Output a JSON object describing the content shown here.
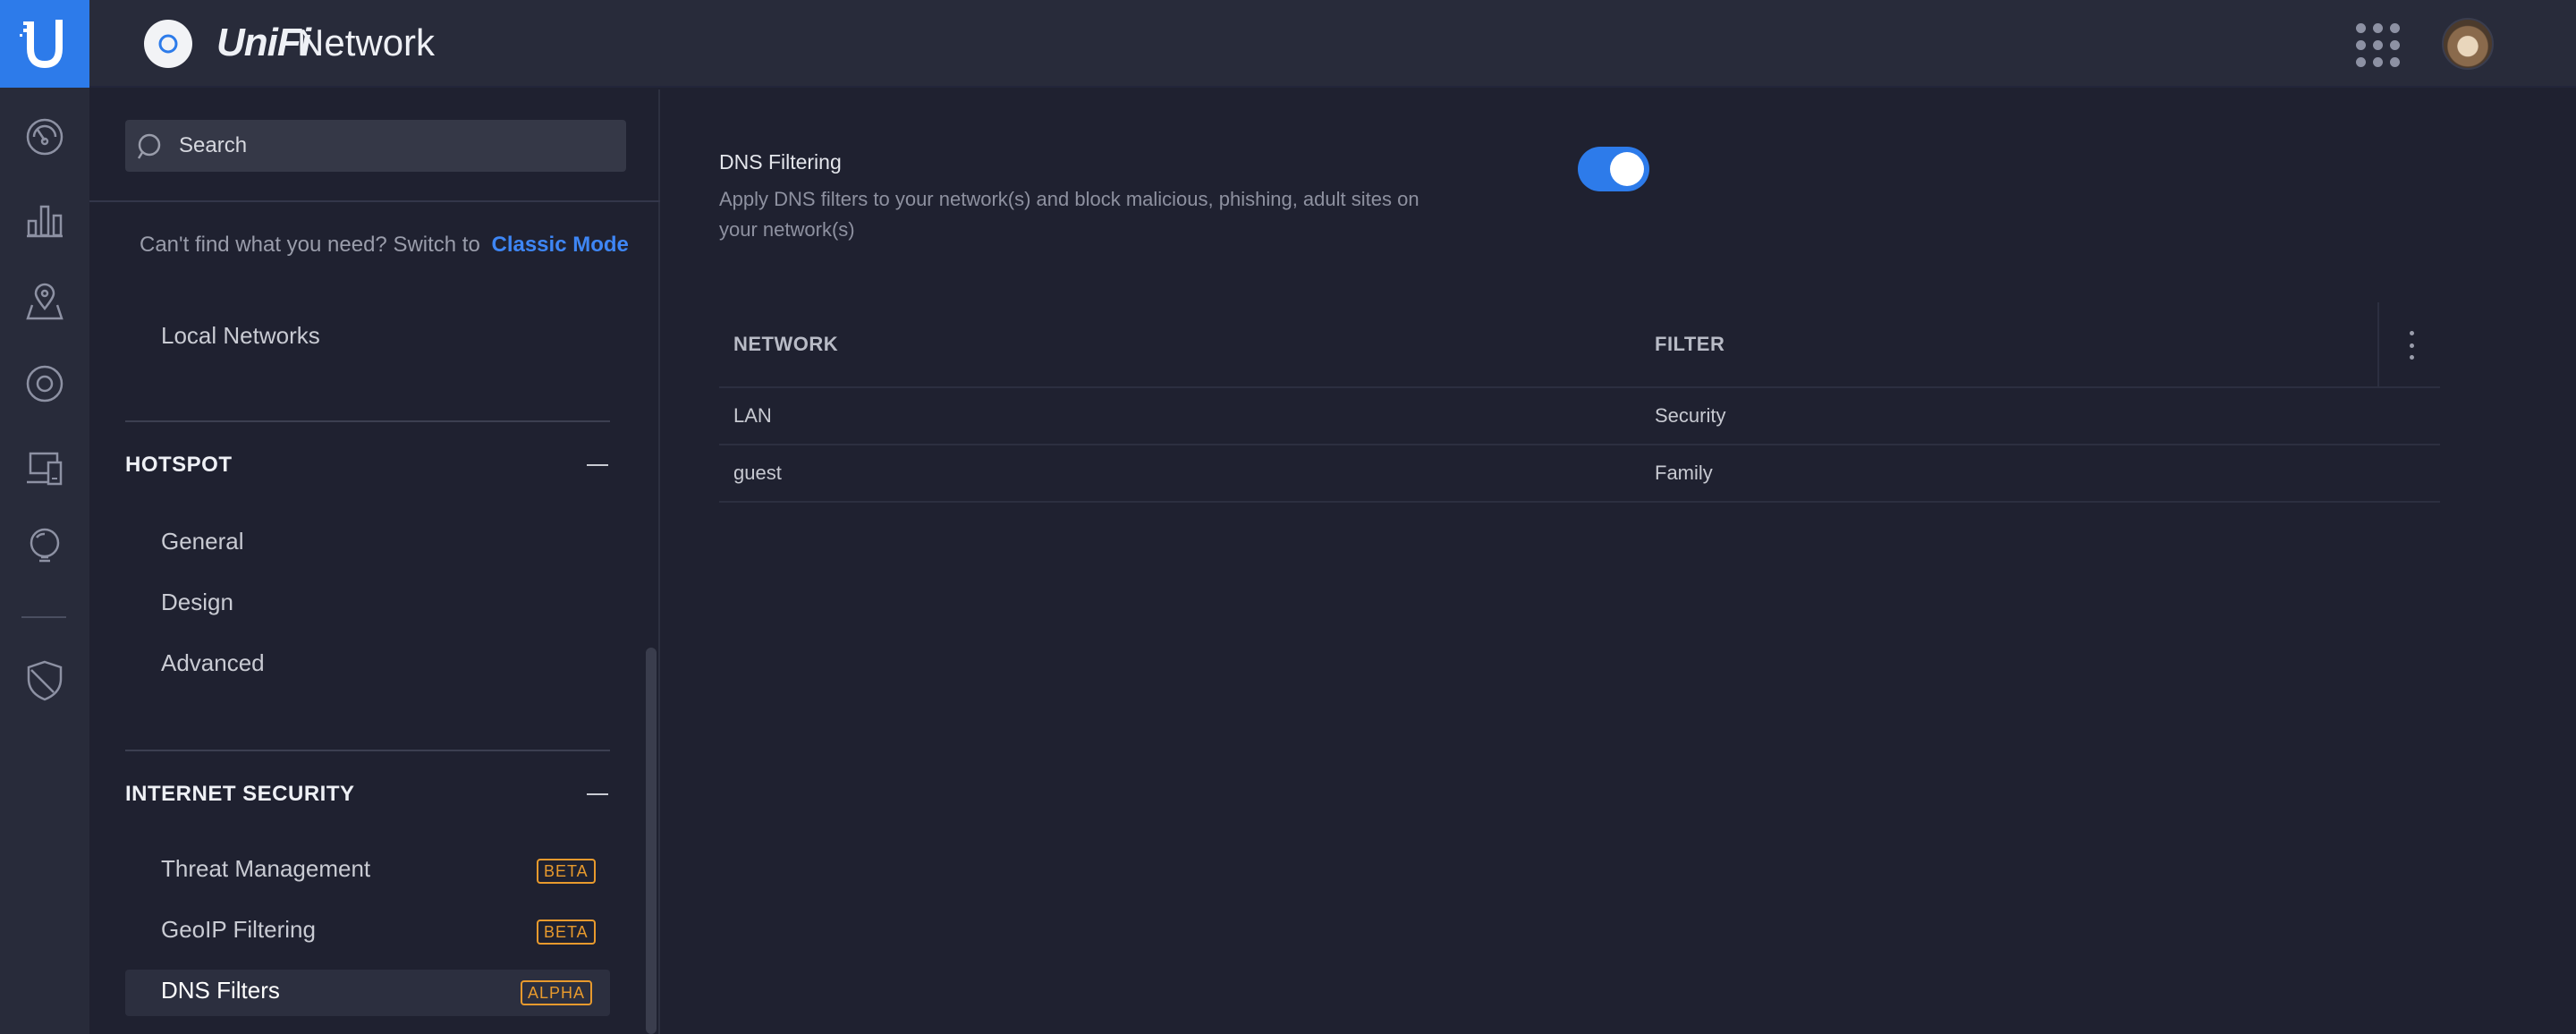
{
  "app": {
    "brand_prefix": "UniFi",
    "brand_name": "Network"
  },
  "search": {
    "placeholder": "Search"
  },
  "sidebar": {
    "classic_prompt": "Can't find what you need? Switch to",
    "classic_link": "Classic Mode",
    "local_networks": "Local Networks",
    "sections": [
      {
        "title": "HOTSPOT",
        "items": [
          {
            "label": "General"
          },
          {
            "label": "Design"
          },
          {
            "label": "Advanced"
          }
        ]
      },
      {
        "title": "INTERNET SECURITY",
        "items": [
          {
            "label": "Threat Management",
            "badge": "BETA"
          },
          {
            "label": "GeoIP Filtering",
            "badge": "BETA"
          },
          {
            "label": "DNS Filters",
            "badge": "ALPHA",
            "active": true
          }
        ]
      }
    ]
  },
  "main": {
    "dns_filtering": {
      "title": "DNS Filtering",
      "description": "Apply DNS filters to your network(s) and block malicious, phishing, adult sites on your network(s)",
      "enabled": true
    },
    "table": {
      "headers": [
        "NETWORK",
        "FILTER"
      ],
      "rows": [
        {
          "network": "LAN",
          "filter": "Security"
        },
        {
          "network": "guest",
          "filter": "Family"
        }
      ]
    }
  },
  "colors": {
    "accent": "#2d7bea",
    "badge": "#e89a2d",
    "background": "#1f2130",
    "panel": "#282b3a"
  },
  "icons": [
    "unifi-logo-icon",
    "dashboard-icon",
    "statistics-icon",
    "map-icon",
    "devices-icon",
    "clients-icon",
    "insights-icon",
    "security-icon",
    "search-icon",
    "apps-grid-icon",
    "more-icon"
  ]
}
